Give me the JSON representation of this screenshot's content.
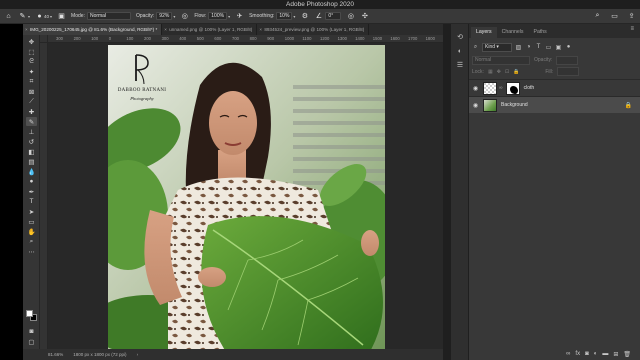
{
  "app": {
    "title": "Adobe Photoshop 2020"
  },
  "options_bar": {
    "brush_size": "40",
    "mode_label": "Mode:",
    "mode_value": "Normal",
    "opacity_label": "Opacity:",
    "opacity_value": "92%",
    "flow_label": "Flow:",
    "flow_value": "100%",
    "smoothing_label": "Smoothing:",
    "smoothing_value": "10%",
    "angle_value": "0°"
  },
  "tabs": [
    {
      "label": "IMG_20200225_170645.jpg @ 81.6% (Background, RGB/8*) *",
      "active": true
    },
    {
      "label": "unnamed.png @ 100% (Layer 1, RGB/8)",
      "active": false
    },
    {
      "label": "8934524_preview.png @ 100% (Layer 1, RGB/8)",
      "active": false
    }
  ],
  "ruler": {
    "ticks": [
      "300",
      "200",
      "100",
      "0",
      "100",
      "200",
      "300",
      "400",
      "500",
      "600",
      "700",
      "800",
      "900",
      "1000",
      "1100",
      "1200",
      "1300",
      "1400",
      "1500",
      "1600",
      "1700",
      "1800"
    ]
  },
  "watermark": {
    "name": "DABBOO RATNANI",
    "sub": "Photography"
  },
  "status_bar": {
    "zoom": "81.66%",
    "doc_size": "1800 px x 1800 px (72 ppi)"
  },
  "layers_panel": {
    "tabs": [
      "Layers",
      "Channels",
      "Paths"
    ],
    "kind_label": "Kind",
    "blend_mode": "Normal",
    "opacity_label": "Opacity:",
    "lock_label": "Lock:",
    "fill_label": "Fill:",
    "layers": [
      {
        "name": "cloth",
        "selected": false,
        "has_mask": true
      },
      {
        "name": "Background",
        "selected": true,
        "has_mask": false
      }
    ]
  },
  "colors": {
    "ui_dark": "#383838",
    "canvas_bg": "#282828",
    "selected_layer": "#4b4b4b"
  }
}
